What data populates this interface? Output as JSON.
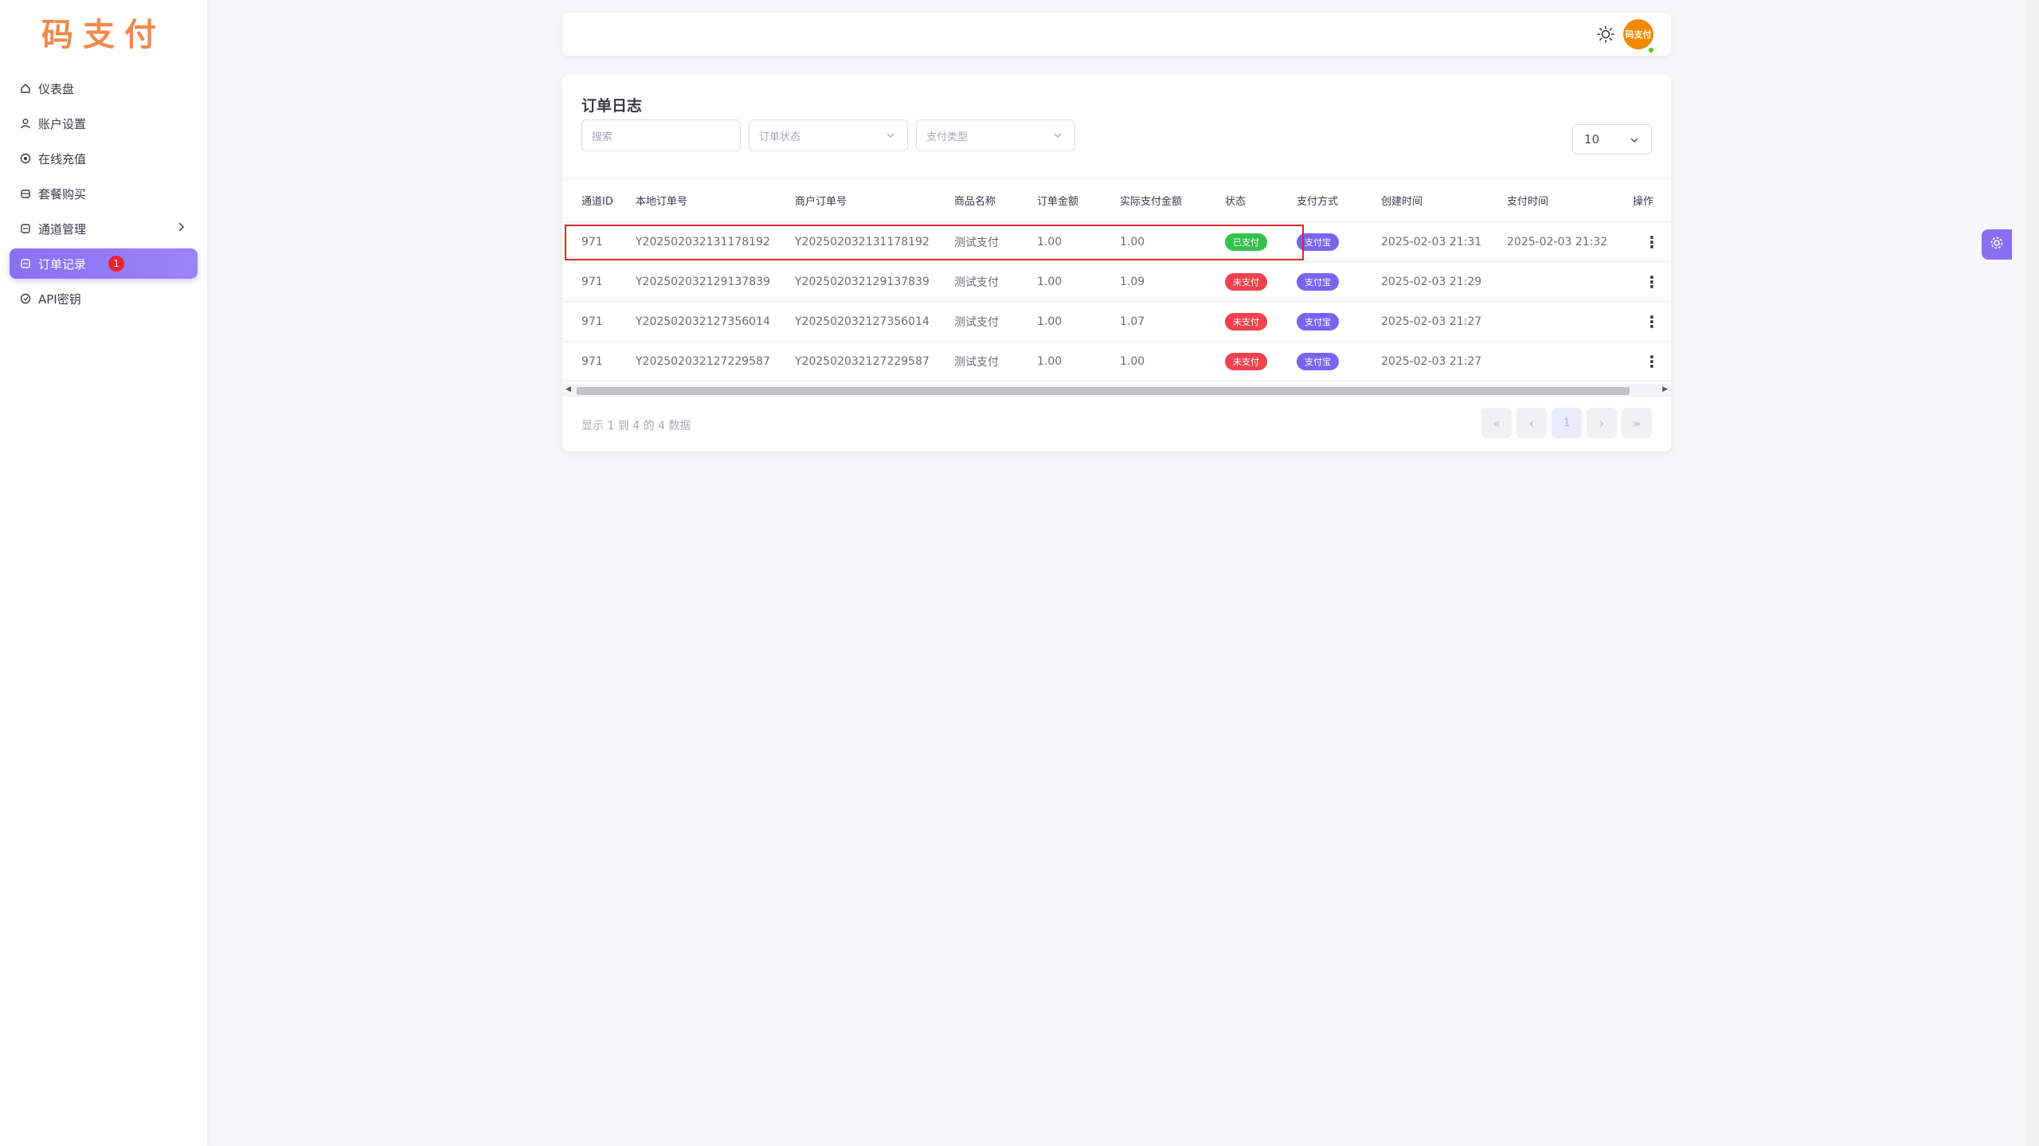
{
  "app": {
    "logo": "码支付"
  },
  "sidebar": {
    "items": [
      {
        "label": "仪表盘",
        "icon": "home-icon"
      },
      {
        "label": "账户设置",
        "icon": "user-icon"
      },
      {
        "label": "在线充值",
        "icon": "coin-icon"
      },
      {
        "label": "套餐购买",
        "icon": "package-icon"
      },
      {
        "label": "通道管理",
        "icon": "channel-icon"
      },
      {
        "label": "订单记录",
        "icon": "order-icon",
        "badge": "1",
        "active": true
      },
      {
        "label": "API密钥",
        "icon": "key-icon"
      }
    ]
  },
  "topbar": {
    "avatar_text": "码支付",
    "theme_icon": "sun-icon"
  },
  "orders": {
    "title": "订单日志",
    "search_placeholder": "搜索",
    "status_filter_placeholder": "订单状态",
    "type_filter_placeholder": "支付类型",
    "per_page": "10",
    "columns": [
      "通道ID",
      "本地订单号",
      "商户订单号",
      "商品名称",
      "订单金额",
      "实际支付金额",
      "状态",
      "支付方式",
      "创建时间",
      "支付时间",
      "操作"
    ],
    "rows": [
      {
        "channel_id": "971",
        "local_no": "Y202502032131178192",
        "merchant_no": "Y202502032131178192",
        "product": "测试支付",
        "amount": "1.00",
        "paid_amount": "1.00",
        "status": "已支付",
        "method": "支付宝",
        "created": "2025-02-03 21:31",
        "paid_time": "2025-02-03 21:32"
      },
      {
        "channel_id": "971",
        "local_no": "Y202502032129137839",
        "merchant_no": "Y202502032129137839",
        "product": "测试支付",
        "amount": "1.00",
        "paid_amount": "1.09",
        "status": "未支付",
        "method": "支付宝",
        "created": "2025-02-03 21:29",
        "paid_time": ""
      },
      {
        "channel_id": "971",
        "local_no": "Y202502032127356014",
        "merchant_no": "Y202502032127356014",
        "product": "测试支付",
        "amount": "1.00",
        "paid_amount": "1.07",
        "status": "未支付",
        "method": "支付宝",
        "created": "2025-02-03 21:27",
        "paid_time": ""
      },
      {
        "channel_id": "971",
        "local_no": "Y202502032127229587",
        "merchant_no": "Y202502032127229587",
        "product": "测试支付",
        "amount": "1.00",
        "paid_amount": "1.00",
        "status": "未支付",
        "method": "支付宝",
        "created": "2025-02-03 21:27",
        "paid_time": ""
      }
    ],
    "footer_info": "显示 1 到 4 的 4 数据",
    "pagination": {
      "first": "«",
      "prev": "‹",
      "current": "1",
      "next": "›",
      "last": "»"
    }
  },
  "colors": {
    "accent": "#8a6ff5",
    "paid": "#33c24d",
    "unpaid": "#f0434d",
    "logo": "#f08a4b"
  }
}
